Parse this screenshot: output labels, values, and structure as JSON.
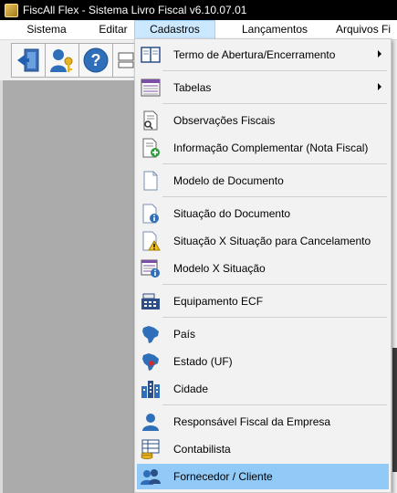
{
  "window": {
    "title": "FiscAll Flex - Sistema Livro Fiscal v6.10.07.01"
  },
  "menubar": {
    "items": [
      {
        "label": "Sistema"
      },
      {
        "label": "Editar"
      },
      {
        "label": "Cadastros"
      },
      {
        "label": "Lançamentos"
      },
      {
        "label": "Arquivos Fi"
      }
    ],
    "active": "Cadastros"
  },
  "toolbar": {
    "buttons": [
      {
        "icon": "exit-door-icon"
      },
      {
        "icon": "user-key-icon"
      },
      {
        "icon": "help-icon"
      },
      {
        "icon": "window-icon"
      }
    ]
  },
  "cadastros_menu": {
    "items": [
      {
        "label": "Termo de Abertura/Encerramento",
        "icon": "book-icon",
        "submenu": true
      },
      {
        "label": "Tabelas",
        "icon": "table-icon",
        "submenu": true
      },
      {
        "label": "Observações Fiscais",
        "icon": "document-search-icon"
      },
      {
        "label": "Informação Complementar (Nota Fiscal)",
        "icon": "document-add-icon"
      },
      {
        "label": "Modelo de Documento",
        "icon": "blank-document-icon"
      },
      {
        "label": "Situação do Documento",
        "icon": "document-info-icon"
      },
      {
        "label": "Situação X Situação para Cancelamento",
        "icon": "document-warning-icon"
      },
      {
        "label": "Modelo X Situação",
        "icon": "table-info-icon"
      },
      {
        "label": "Equipamento ECF",
        "icon": "cash-register-icon"
      },
      {
        "label": "País",
        "icon": "brazil-map-icon"
      },
      {
        "label": "Estado (UF)",
        "icon": "brazil-state-icon"
      },
      {
        "label": "Cidade",
        "icon": "city-buildings-icon"
      },
      {
        "label": "Responsável Fiscal da Empresa",
        "icon": "person-icon"
      },
      {
        "label": "Contabilista",
        "icon": "accountant-icon"
      },
      {
        "label": "Fornecedor / Cliente",
        "icon": "people-icon",
        "highlighted": true
      }
    ]
  },
  "colors": {
    "titlebar_bg": "#000000",
    "menu_active_bg": "#cce8ff",
    "menu_hover_bg": "#91c9f7",
    "dropdown_bg": "#f2f2f2",
    "workspace_bg": "#ababab"
  }
}
